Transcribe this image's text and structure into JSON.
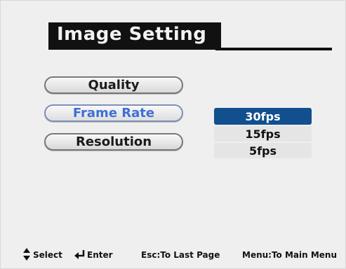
{
  "header": {
    "title": "Image Setting"
  },
  "menu": {
    "items": [
      {
        "label": "Quality",
        "selected": false
      },
      {
        "label": "Frame Rate",
        "selected": true
      },
      {
        "label": "Resolution",
        "selected": false
      }
    ]
  },
  "frame_rate_options": {
    "items": [
      {
        "label": "30fps",
        "selected": true
      },
      {
        "label": "15fps",
        "selected": false
      },
      {
        "label": "5fps",
        "selected": false
      }
    ]
  },
  "footer": {
    "select_label": "Select",
    "enter_label": "Enter",
    "esc_label": "Esc:To Last Page",
    "menu_label": "Menu:To Main Menu",
    "icons": [
      "up-down-arrow-icon",
      "enter-icon"
    ]
  },
  "colors": {
    "selected_text": "#3f6fd6",
    "selected_option_bg": "#114f8f",
    "screen_bg": "#efefef",
    "title_bg": "#111111"
  }
}
